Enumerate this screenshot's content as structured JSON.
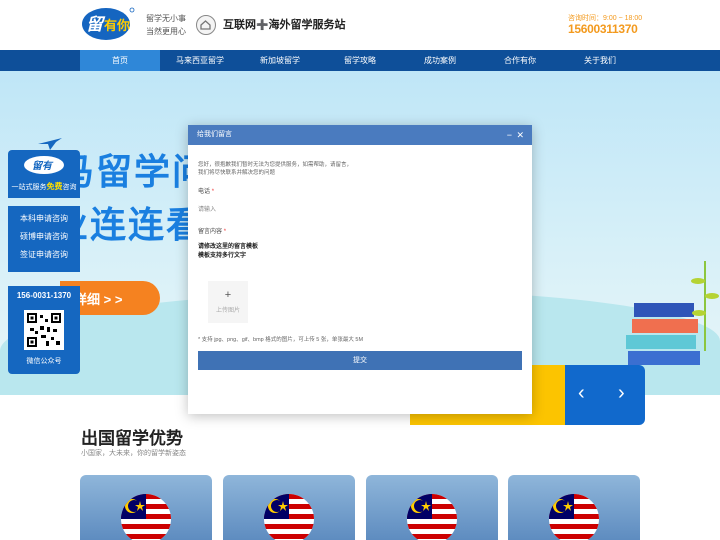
{
  "header": {
    "slogan": [
      "留学无小事",
      "当然更用心"
    ],
    "site_name": "互联网",
    "site_name_plus": "➕",
    "site_name_tail": "海外留学服务站",
    "hotline_label": "咨询时间：9:00 ~ 18:00",
    "hotline_number": "15600311370"
  },
  "nav": {
    "items": [
      {
        "label": "首页"
      },
      {
        "label": "马来西亚留学"
      },
      {
        "label": "新加坡留学"
      },
      {
        "label": "留学攻略"
      },
      {
        "label": "成功案例"
      },
      {
        "label": "合作有你"
      },
      {
        "label": "关于我们"
      }
    ],
    "active_index": 0
  },
  "hero": {
    "line1": "马留学问",
    "line2": "业连连看",
    "cta": "详细 > >"
  },
  "float_panel": {
    "service": "一站式服务",
    "free": "免费",
    "consult": "咨询",
    "items": [
      "本科申请咨询",
      "硕博申请咨询",
      "签证申请咨询"
    ],
    "phone": "156-0031-1370",
    "qr_caption": "微信公众号"
  },
  "modal": {
    "title": "给我们留言",
    "intro": [
      "您好，很抱歉我们暂时无法为您提供服务，如需帮助，请留言，",
      "我们将尽快联系并解决您的问题"
    ],
    "phone_label": "电话",
    "phone_placeholder": "请输入",
    "content_label": "留言内容",
    "content_lines": [
      "请修改这里的留言模板",
      "模板支持多行文字"
    ],
    "upload_label": "上传图片",
    "hint": "* 支持 jpg、png、gif、bmp 格式的图片，可上传 5 张，单张最大 5M",
    "submit": "提交"
  },
  "section": {
    "title": "出国留学优势",
    "subtitle": "小国家，大未来，你的留学新姿态"
  },
  "colors": {
    "nav": "#0e4f99",
    "accent_orange": "#f58220",
    "hotline": "#f39a1e",
    "modal_header": "#4a7bbf"
  }
}
